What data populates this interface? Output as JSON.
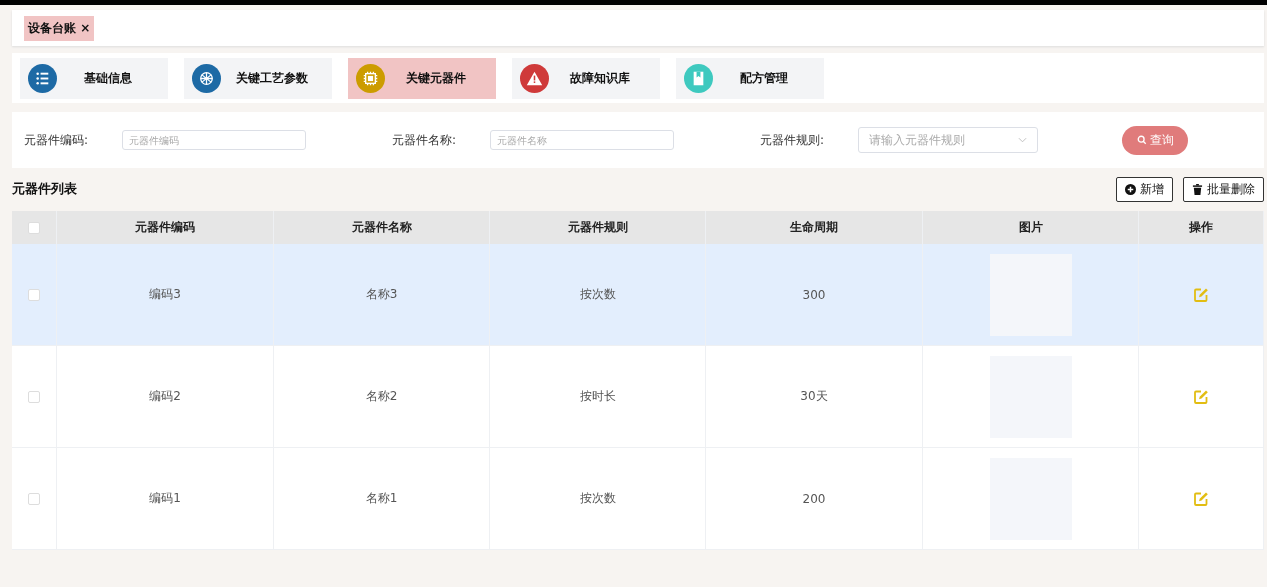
{
  "tab_bar": {
    "tabs": [
      {
        "label": "设备台账",
        "close": "×",
        "selected": true
      }
    ]
  },
  "modules": [
    {
      "label": "基础信息",
      "color": "#1d6aa5",
      "selected": false
    },
    {
      "label": "关键工艺参数",
      "color": "#1d6aa5",
      "selected": false
    },
    {
      "label": "关键元器件",
      "color": "#cc9c00",
      "selected": true
    },
    {
      "label": "故障知识库",
      "color": "#cf3a3a",
      "selected": false
    },
    {
      "label": "配方管理",
      "color": "#3ec9bf",
      "selected": false
    }
  ],
  "filters": [
    {
      "label": "元器件编码:",
      "kind": "input",
      "placeholder": "元器件编码"
    },
    {
      "label": "元器件名称:",
      "kind": "input",
      "placeholder": "元器件名称"
    },
    {
      "label": "元器件规则:",
      "kind": "select",
      "placeholder": "请输入元器件规则"
    }
  ],
  "search_button": "查询",
  "list_title": "元器件列表",
  "actions": [
    "新增",
    "批量删除"
  ],
  "table": {
    "header_checked": false,
    "columns": [
      "元器件编码",
      "元器件名称",
      "元器件规则",
      "生命周期",
      "图片",
      "操作"
    ],
    "rows": [
      {
        "checked": false,
        "selected": true,
        "cells": [
          "编码3",
          "名称3",
          "按次数",
          "300"
        ]
      },
      {
        "checked": false,
        "selected": false,
        "cells": [
          "编码2",
          "名称2",
          "按时长",
          "30天"
        ]
      },
      {
        "checked": false,
        "selected": false,
        "cells": [
          "编码1",
          "名称1",
          "按次数",
          "200"
        ]
      }
    ]
  }
}
